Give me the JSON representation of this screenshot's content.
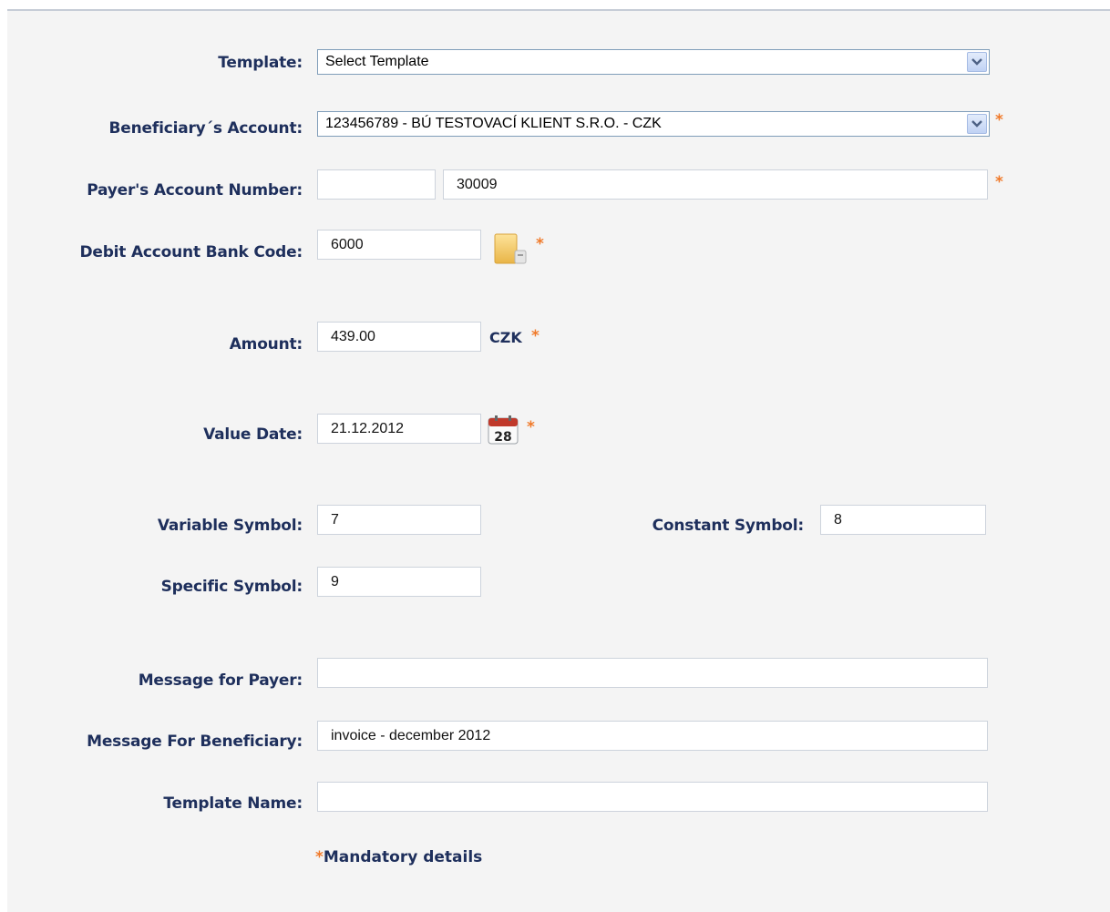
{
  "labels": {
    "template": "Template:",
    "beneficiary_account": "Beneficiary´s Account:",
    "payer_account_number": "Payer's Account Number:",
    "debit_bank_code": "Debit Account Bank Code:",
    "amount": "Amount:",
    "value_date": "Value Date:",
    "variable_symbol": "Variable Symbol:",
    "constant_symbol": "Constant Symbol:",
    "specific_symbol": "Specific Symbol:",
    "message_for_payer": "Message for Payer:",
    "message_for_beneficiary": "Message For Beneficiary:",
    "template_name": "Template Name:"
  },
  "values": {
    "template": "Select Template",
    "beneficiary_account": "123456789 - BÚ TESTOVACÍ KLIENT S.R.O. - CZK",
    "payer_prefix": "",
    "payer_account_number": "30009",
    "debit_bank_code": "6000",
    "amount": "439.00",
    "currency": "CZK",
    "value_date": "21.12.2012",
    "variable_symbol": "7",
    "constant_symbol": "8",
    "specific_symbol": "9",
    "message_for_payer": "",
    "message_for_beneficiary": "invoice - december 2012",
    "template_name": ""
  },
  "icons": {
    "bank_code_lookup": "folder-icon",
    "calendar": "calendar-icon",
    "calendar_day": "28",
    "dropdown": "chevron-down-icon"
  },
  "required_marker": "*",
  "footer": {
    "mandatory_text": "Mandatory details"
  },
  "colors": {
    "label": "#1e2f5c",
    "required": "#f07a2a",
    "panel": "#f4f4f4"
  }
}
